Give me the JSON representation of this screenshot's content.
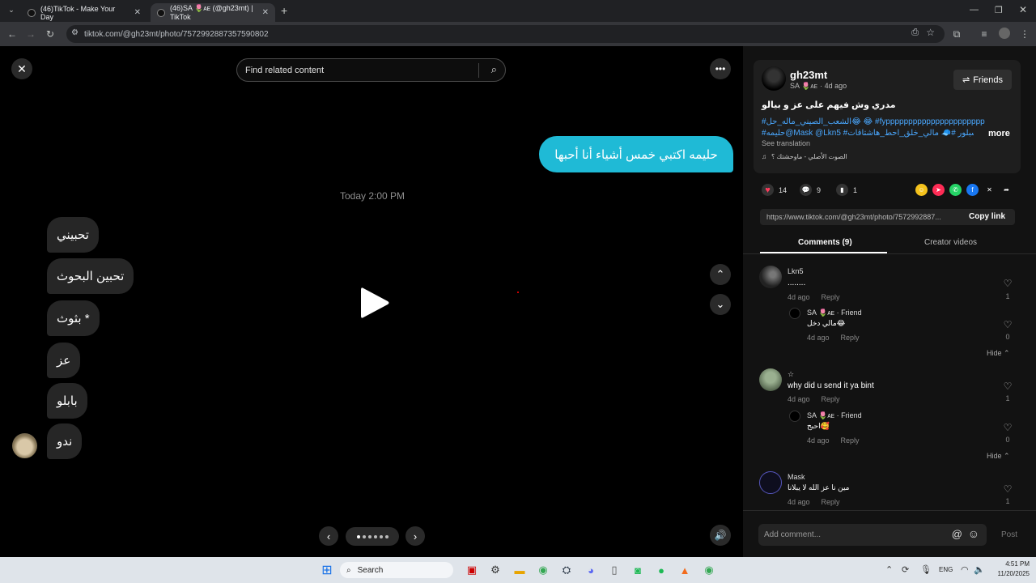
{
  "browser": {
    "tabs": [
      {
        "title": "(46)TikTok - Make Your Day"
      },
      {
        "title": "(46)SA 🌷ᴀᴇ (@gh23mt) | TikTok"
      }
    ],
    "url": "tiktok.com/@gh23mt/photo/7572992887357590802"
  },
  "viewer": {
    "search_placeholder": "Find related content",
    "right_bubble": "حليمه اكتبي خمس أشياء أنا أحبها",
    "timestamp": "Today 2:00 PM",
    "left_bubbles": [
      "تحبيني",
      "تحبين البحوث",
      "بثوث *",
      "عز",
      "بابلو",
      "ندو"
    ]
  },
  "post": {
    "username": "gh23mt",
    "display_name": "SA 🌷ᴀᴇ",
    "age": "· 4d ago",
    "friends_button": "Friends",
    "caption": "مدري وش فيهم على عز و بيالو",
    "hashtags_line1": "#الشعب_الصيني_ماله_حل😂 😂 #fypppppppppppppppppppppp",
    "hashtags_line2": "#حليمه@Mask @Lkn5 #اكسبلور #🧢 مالي_خلق_احط_هاشتاقات",
    "more": "more",
    "see_translation": "See translation",
    "sound": "الصوت الأصلي - ماوحشتك ؟",
    "likes": "14",
    "comments": "9",
    "saves": "1",
    "link": "https://www.tiktok.com/@gh23mt/photo/7572992887...",
    "copy_link": "Copy link",
    "tab_comments": "Comments (9)",
    "tab_creator": "Creator videos"
  },
  "comments": [
    {
      "user": "Lkn5",
      "text": "........",
      "meta_time": "4d ago",
      "reply": "Reply",
      "likes": "1",
      "sub": {
        "user": "SA 🌷ᴀᴇ · Friend",
        "text": "مالي دخل😂",
        "meta_time": "4d ago",
        "reply": "Reply",
        "likes": "0"
      },
      "hide": "Hide ⌃"
    },
    {
      "user": "☆",
      "text": "why did u send it ya bint",
      "meta_time": "4d ago",
      "reply": "Reply",
      "likes": "1",
      "sub": {
        "user": "SA 🌷ᴀᴇ · Friend",
        "text": "احبح🥰",
        "meta_time": "4d ago",
        "reply": "Reply",
        "likes": "0"
      },
      "hide": "Hide ⌃"
    },
    {
      "user": "Mask",
      "text": "مين نا عز الله لا يبلانا",
      "meta_time": "4d ago",
      "reply": "Reply",
      "likes": "1"
    }
  ],
  "composer": {
    "placeholder": "Add comment...",
    "post": "Post"
  },
  "taskbar": {
    "search": "Search",
    "lang": "ENG",
    "time": "4:51 PM",
    "date": "11/20/2025"
  }
}
